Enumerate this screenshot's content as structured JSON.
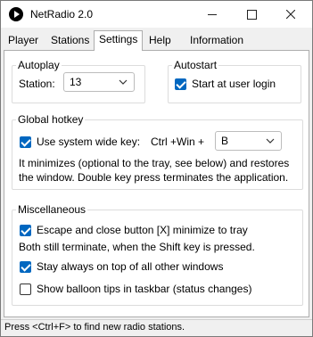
{
  "window": {
    "title": "NetRadio 2.0"
  },
  "tabs": [
    {
      "label": "Player"
    },
    {
      "label": "Stations"
    },
    {
      "label": "Settings",
      "active": true
    },
    {
      "label": "Help"
    },
    {
      "label": "Information"
    }
  ],
  "autoplay": {
    "legend": "Autoplay",
    "station_label": "Station:",
    "station_value": "13"
  },
  "autostart": {
    "legend": "Autostart",
    "checkbox_label": "Start at user login",
    "checked": true
  },
  "hotkey": {
    "legend": "Global hotkey",
    "checkbox_label": "Use system wide key:",
    "checked": true,
    "modifiers": "Ctrl +Win +",
    "key_value": "B",
    "description_line1": "It minimizes (optional to the tray, see below) and restores",
    "description_line2": "the window. Double key press terminates the application."
  },
  "misc": {
    "legend": "Miscellaneous",
    "escape_label": "Escape and close button [X] minimize to tray",
    "escape_checked": true,
    "escape_note": "Both still terminate, when the Shift key is pressed.",
    "ontop_label": "Stay always on top of all other windows",
    "ontop_checked": true,
    "balloon_label": "Show balloon tips in taskbar (status changes)",
    "balloon_checked": false
  },
  "statusbar": {
    "text": "Press <Ctrl+F> to find new radio stations."
  },
  "colors": {
    "accent": "#0067c0",
    "window_bg": "#f0f0f0",
    "panel_bg": "#ffffff"
  },
  "icons": [
    "app-play-icon",
    "minimize-icon",
    "maximize-icon",
    "close-icon",
    "chevron-down-icon",
    "checkbox-check-icon"
  ]
}
